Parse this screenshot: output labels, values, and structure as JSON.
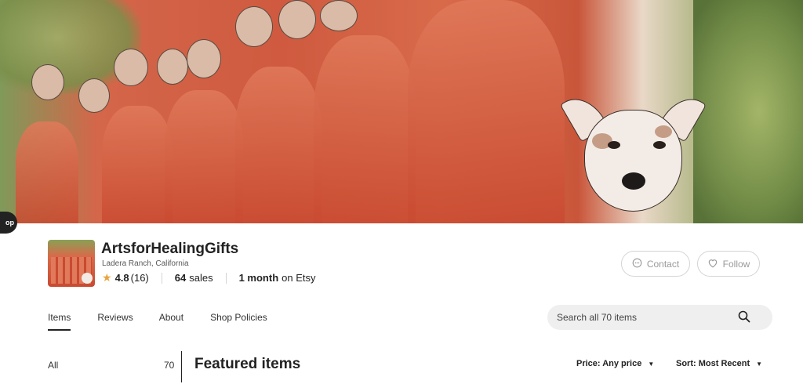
{
  "side_tab": {
    "label": "op"
  },
  "shop": {
    "name": "ArtsforHealingGifts",
    "location": "Ladera Ranch, California",
    "rating": "4.8",
    "review_count": "(16)",
    "sales": "64",
    "sales_label": "sales",
    "time": "1 month",
    "time_label": "on Etsy"
  },
  "actions": {
    "contact_label": "Contact",
    "follow_label": "Follow"
  },
  "nav": {
    "tabs": [
      {
        "label": "Items",
        "active": true
      },
      {
        "label": "Reviews"
      },
      {
        "label": "About"
      },
      {
        "label": "Shop Policies"
      }
    ]
  },
  "search": {
    "placeholder": "Search all 70 items"
  },
  "sidebar": {
    "all_label": "All",
    "all_count": "70"
  },
  "main": {
    "title": "Featured items",
    "price_filter": "Price: Any price",
    "sort_filter": "Sort: Most Recent"
  },
  "colors": {
    "star": "#e8a53e",
    "banner_red": "#cf5a3f"
  },
  "icons": [
    "star-icon",
    "chat-icon",
    "heart-icon",
    "search-icon",
    "caret-down-icon"
  ]
}
